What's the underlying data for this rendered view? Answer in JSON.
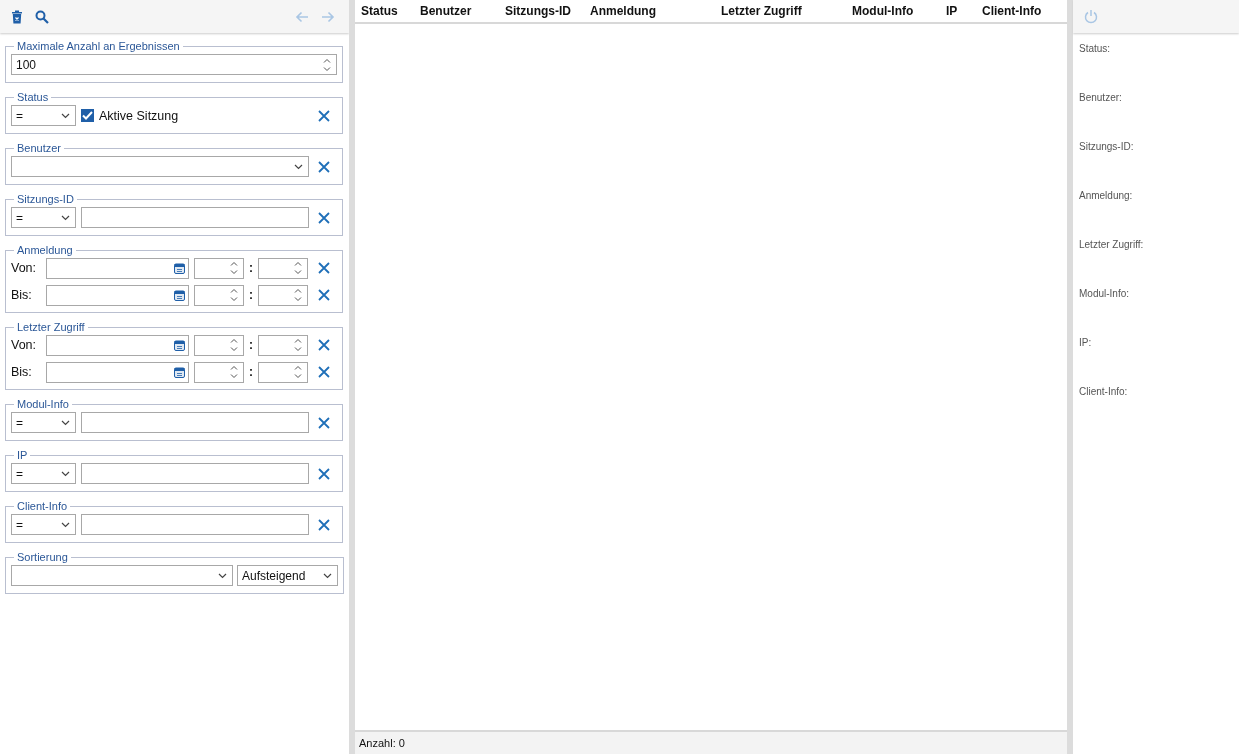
{
  "toolbar": {
    "back_disabled": true,
    "forward_disabled": true
  },
  "filters": [
    {
      "kind": "number",
      "legend": "Maximale Anzahl an Ergebnissen",
      "value": "100"
    },
    {
      "kind": "checkbox",
      "legend": "Status",
      "operator": "=",
      "label": "Aktive Sitzung",
      "checked": true
    },
    {
      "kind": "select",
      "legend": "Benutzer"
    },
    {
      "kind": "text",
      "legend": "Sitzungs-ID",
      "operator": "="
    },
    {
      "kind": "daterange",
      "legend": "Anmeldung",
      "rows": [
        {
          "label": "Von:",
          "separator": ":"
        },
        {
          "label": "Bis:",
          "separator": ":"
        }
      ]
    },
    {
      "kind": "daterange",
      "legend": "Letzter Zugriff",
      "rows": [
        {
          "label": "Von:",
          "separator": ":"
        },
        {
          "label": "Bis:",
          "separator": ":"
        }
      ]
    },
    {
      "kind": "text",
      "legend": "Modul-Info",
      "operator": "="
    },
    {
      "kind": "text",
      "legend": "IP",
      "operator": "="
    },
    {
      "kind": "text",
      "legend": "Client-Info",
      "operator": "="
    },
    {
      "kind": "sort",
      "legend": "Sortierung",
      "direction": "Aufsteigend"
    }
  ],
  "table": {
    "columns": [
      "Status",
      "Benutzer",
      "Sitzungs-ID",
      "Anmeldung",
      "Letzter Zugriff",
      "Modul-Info",
      "IP",
      "Client-Info"
    ],
    "footer": "Anzahl: 0"
  },
  "details": {
    "power_disabled": true,
    "labels": [
      "Status:",
      "Benutzer:",
      "Sitzungs-ID:",
      "Anmeldung:",
      "Letzter Zugriff:",
      "Modul-Info:",
      "IP:",
      "Client-Info:"
    ]
  }
}
